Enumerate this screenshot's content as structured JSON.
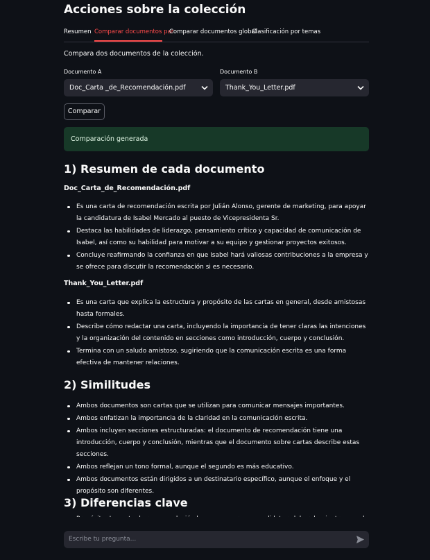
{
  "title": "Acciones sobre la colección",
  "tabs": [
    "Resumen",
    "Comparar documentos par",
    "Comparar documentos global",
    "Clasificación por temas"
  ],
  "active_tab": "Comparar documentos par",
  "description": "Compara dos documentos de la colección.",
  "doc_a": {
    "label": "Documento A",
    "value": "Doc_Carta _de_Recomendación.pdf"
  },
  "doc_b": {
    "label": "Documento B",
    "value": "Thank_You_Letter.pdf"
  },
  "compare_button": "Comparar",
  "success_message": "Comparación generada",
  "section1": {
    "heading": "1) Resumen de cada documento",
    "doc1_name": "Doc_Carta_de_Recomendación.pdf",
    "doc1_bullets": [
      "Es una carta de recomendación escrita por Julián Alonso, gerente de marketing, para apoyar la candidatura de Isabel Mercado al puesto de Vicepresidenta Sr.",
      "Destaca las habilidades de liderazgo, pensamiento crítico y capacidad de comunicación de Isabel, así como su habilidad para motivar a su equipo y gestionar proyectos exitosos.",
      "Concluye reafirmando la confianza en que Isabel hará valiosas contribuciones a la empresa y se ofrece para discutir la recomendación si es necesario."
    ],
    "doc2_name": "Thank_You_Letter.pdf",
    "doc2_bullets": [
      "Es una carta que explica la estructura y propósito de las cartas en general, desde amistosas hasta formales.",
      "Describe cómo redactar una carta, incluyendo la importancia de tener claras las intenciones y la organización del contenido en secciones como introducción, cuerpo y conclusión.",
      "Termina con un saludo amistoso, sugiriendo que la comunicación escrita es una forma efectiva de mantener relaciones."
    ]
  },
  "section2": {
    "heading": "2) Similitudes",
    "bullets": [
      "Ambos documentos son cartas que se utilizan para comunicar mensajes importantes.",
      "Ambos enfatizan la importancia de la claridad en la comunicación escrita.",
      "Ambos incluyen secciones estructuradas: el documento de recomendación tiene una introducción, cuerpo y conclusión, mientras que el documento sobre cartas describe estas secciones.",
      "Ambos reflejan un tono formal, aunque el segundo es más educativo.",
      "Ambos documentos están dirigidos a un destinatario específico, aunque el enfoque y el propósito son diferentes."
    ]
  },
  "section3": {
    "heading": "3) Diferencias clave",
    "partial_bullet": "Propósito: La carta de recomendación busca apoyar una candidatura laboral, mientras que la otra"
  },
  "chat_placeholder": "Escribe tu pregunta..."
}
